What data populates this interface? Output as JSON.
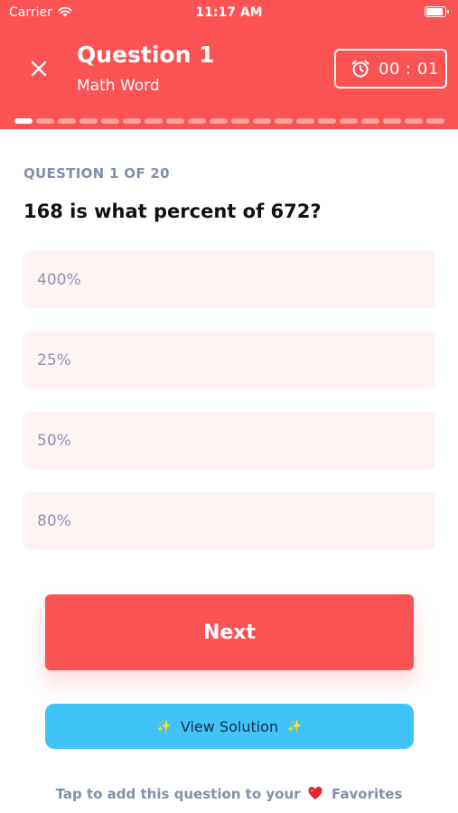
{
  "status_bar": {
    "carrier": "Carrier",
    "time": "11:17 AM",
    "battery_level": 1.0
  },
  "header": {
    "title": "Question 1",
    "subtitle": "Math Word",
    "timer": "00 : 01",
    "close_icon": "close-icon",
    "timer_icon": "alarm-clock-icon"
  },
  "progress": {
    "total": 20,
    "current": 1
  },
  "question": {
    "counter": "QUESTION 1 OF 20",
    "text": "168 is what percent of 672?",
    "options": [
      "400%",
      "25%",
      "50%",
      "80%"
    ]
  },
  "actions": {
    "next_label": "Next",
    "view_solution_label": "View Solution",
    "sparkle_glyph": "✨"
  },
  "favorites": {
    "prefix": "Tap to add this question to your",
    "suffix": "Favorites",
    "heart_icon": "heart-icon"
  },
  "colors": {
    "accent": "#fb5253",
    "solution_button": "#40c4f8",
    "option_background": "#fdf3f3",
    "muted_text": "#8190ab"
  }
}
